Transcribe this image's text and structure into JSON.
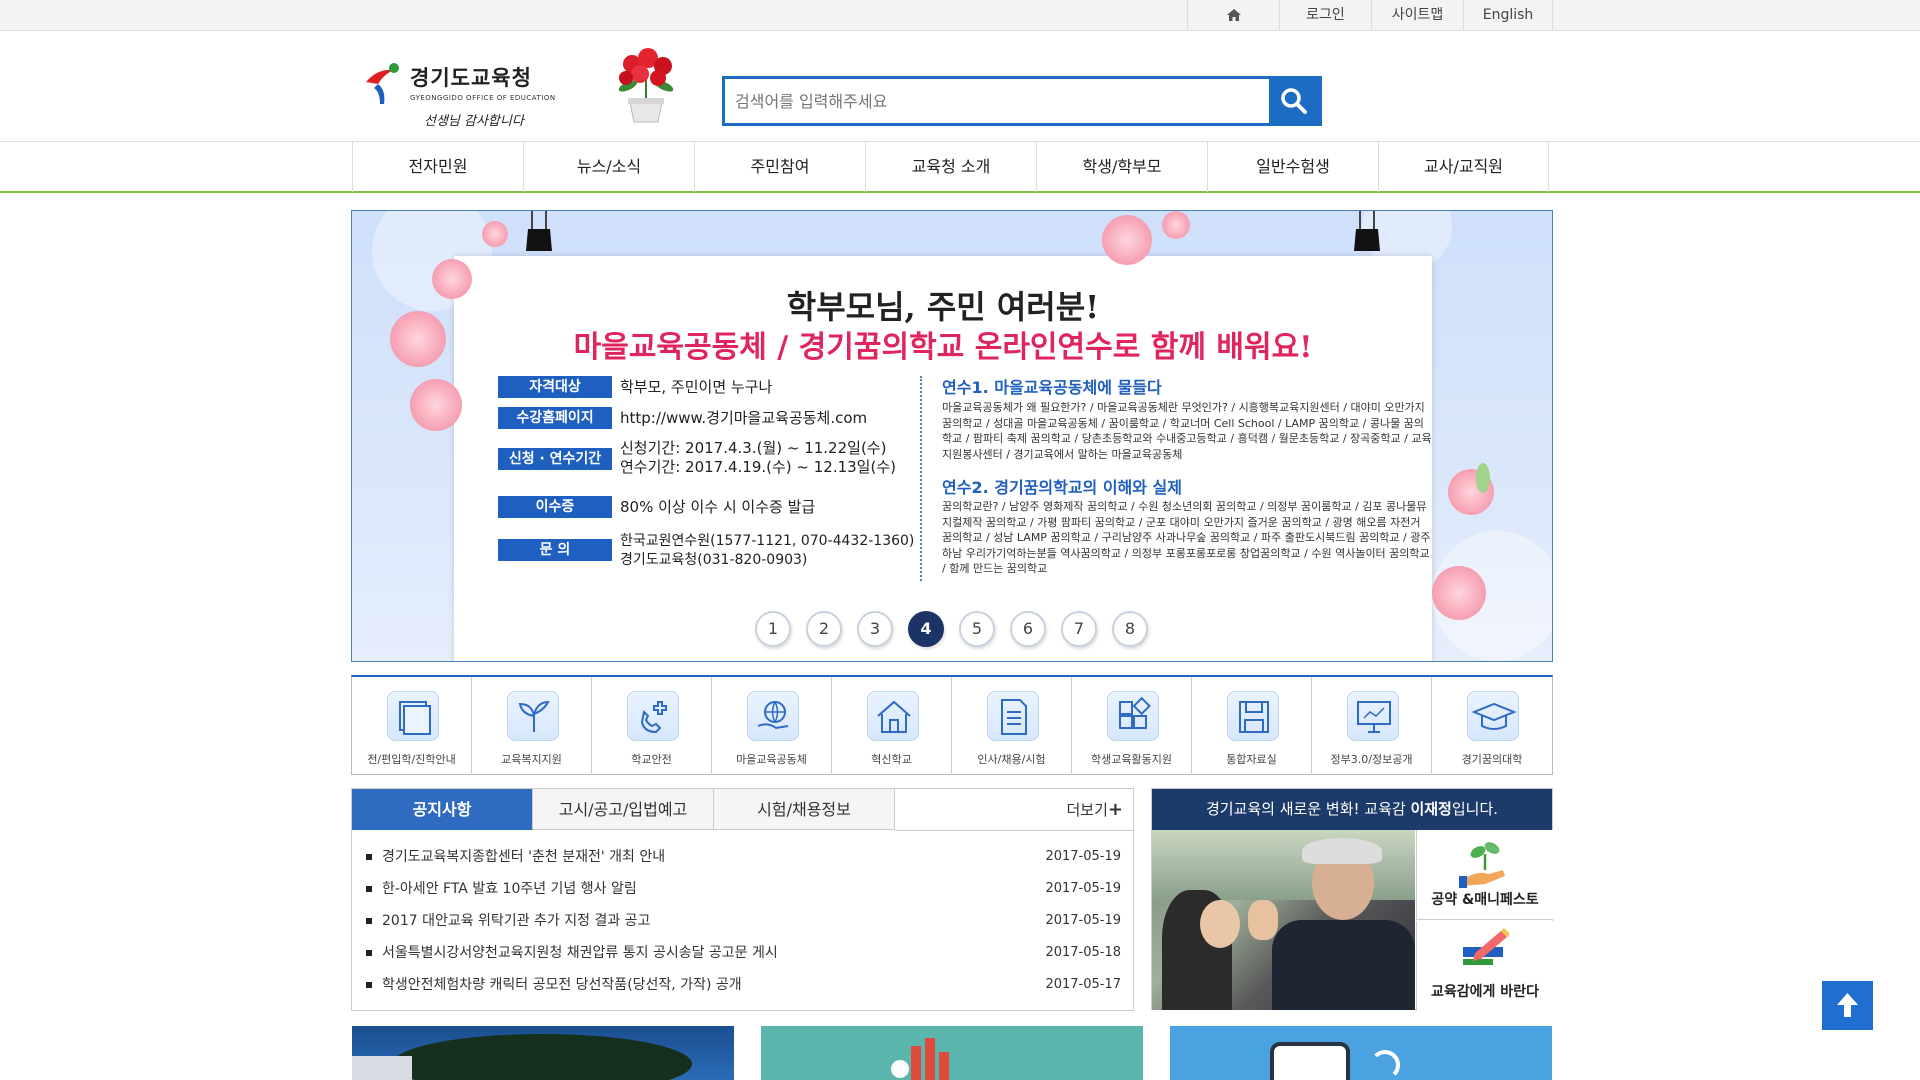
{
  "util_nav": {
    "home_icon": "home-icon",
    "login": "로그인",
    "sitemap": "사이트맵",
    "english": "English"
  },
  "header": {
    "logo_title": "경기도교육청",
    "logo_sub": "GYEONGGIDO OFFICE OF EDUCATION",
    "logo_slogan": "선생님 감사합니다",
    "search_placeholder": "검색어를 입력해주세요"
  },
  "gnb": [
    "전자민원",
    "뉴스/소식",
    "주민참여",
    "교육청 소개",
    "학생/학부모",
    "일반수험생",
    "교사/교직원"
  ],
  "banner": {
    "title1": "학부모님, 주민 여러분!",
    "title2": "마을교육공동체 / 경기꿈의학교 온라인연수로 함께 배워요!",
    "rows": [
      {
        "label": "자격대상",
        "value": "학부모, 주민이면 누구나"
      },
      {
        "label": "수강홈페이지",
        "value": "http://www.경기마을교육공동체.com"
      },
      {
        "label": "신청 · 연수기간",
        "value": "신청기간: 2017.4.3.(월) ~ 11.22일(수)",
        "value2": "연수기간: 2017.4.19.(수) ~ 12.13일(수)"
      },
      {
        "label": "이수증",
        "value": "80% 이상 이수 시 이수증 발급"
      },
      {
        "label": "문 의",
        "value": "한국교원연수원(1577-1121, 070-4432-1360)",
        "value2": "경기도교육청(031-820-0903)"
      }
    ],
    "course1_title": "연수1. 마을교육공동체에 물들다",
    "course1_body": "마을교육공동체가 왜 필요한가? / 마을교육공동체란 무엇인가? / 시흥행복교육지원센터 / 대야미 오만가지 꿈의학교 / 성대골 마을교육공동체 / 꿈이룸학교 / 학교너머 Cell School / LAMP 꿈의학교 / 콩나물 꿈의학교 / 팜파티 축제 꿈의학교 / 당촌초등학교와 수내중고등학교 / 흥덕캠 / 월문초등학교 / 장곡중학교 / 교육지원봉사센터 / 경기교육에서 말하는 마을교육공동체",
    "course2_title": "연수2. 경기꿈의학교의 이해와 실제",
    "course2_body": "꿈의학교란? / 남양주 영화제작 꿈의학교 / 수원 청소년의회 꿈의학교 / 의정부 꿈이룸학교 / 김포 콩나물뮤지컬제작 꿈의학교 / 가평 팜파티 꿈의학교 / 군포 대야미 오만가지 즐거운 꿈의학교 / 광명 해오름 자전거 꿈의학교 / 성남 LAMP 꿈의학교 / 구리남양주 사과나무숲 꿈의학교 / 파주 출판도시북드림 꿈의학교 / 광주하남 우리가기억하는분들 역사꿈의학교 / 의정부 포롱포롱포로롱 창업꿈의학교 / 수원 역사놀이터 꿈의학교 / 함께 만드는 꿈의학교",
    "pages": [
      "1",
      "2",
      "3",
      "4",
      "5",
      "6",
      "7",
      "8"
    ],
    "active_page": "4"
  },
  "quick_links": [
    {
      "label": "전/편입학/진학안내",
      "icon": "documents-icon"
    },
    {
      "label": "교육복지지원",
      "icon": "sprout-icon"
    },
    {
      "label": "학교안전",
      "icon": "medical-phone-icon"
    },
    {
      "label": "마을교육공동체",
      "icon": "globe-hand-icon"
    },
    {
      "label": "혁신학교",
      "icon": "house-icon"
    },
    {
      "label": "인사/채용/시험",
      "icon": "document-icon"
    },
    {
      "label": "학생교육활동지원",
      "icon": "blocks-icon"
    },
    {
      "label": "통합자료실",
      "icon": "floppy-icon"
    },
    {
      "label": "정부3.0/정보공개",
      "icon": "monitor-icon"
    },
    {
      "label": "경기꿈의대학",
      "icon": "graduation-cap-icon"
    }
  ],
  "notice": {
    "tabs": [
      "공지사항",
      "고시/공고/입법예고",
      "시험/채용정보"
    ],
    "more": "더보기",
    "items": [
      {
        "title": "경기도교육복지종합센터 '춘천 분재전' 개최 안내",
        "date": "2017-05-19"
      },
      {
        "title": "한-아세안 FTA 발효 10주년 기념 행사 알림",
        "date": "2017-05-19"
      },
      {
        "title": "2017 대안교육 위탁기관 추가 지정 결과 공고",
        "date": "2017-05-19"
      },
      {
        "title": "서울특별시강서양천교육지원청 채권압류 통지 공시송달 공고문 게시",
        "date": "2017-05-18"
      },
      {
        "title": "학생안전체험차량 캐릭터 공모전 당선작품(당선작, 가작) 공개",
        "date": "2017-05-17"
      }
    ]
  },
  "superintendent": {
    "head_prefix": "경기교육의 새로운 변화! 교육감 ",
    "head_name": "이재정",
    "head_suffix": "입니다.",
    "btn1": "공약 &매니페스토",
    "btn2": "교육감에게 바란다"
  },
  "colors": {
    "brand_blue": "#1f5fbf",
    "gnb_underline": "#7fbf3f",
    "banner_pink": "#e0245e",
    "dark_navy": "#1c3b6a"
  }
}
